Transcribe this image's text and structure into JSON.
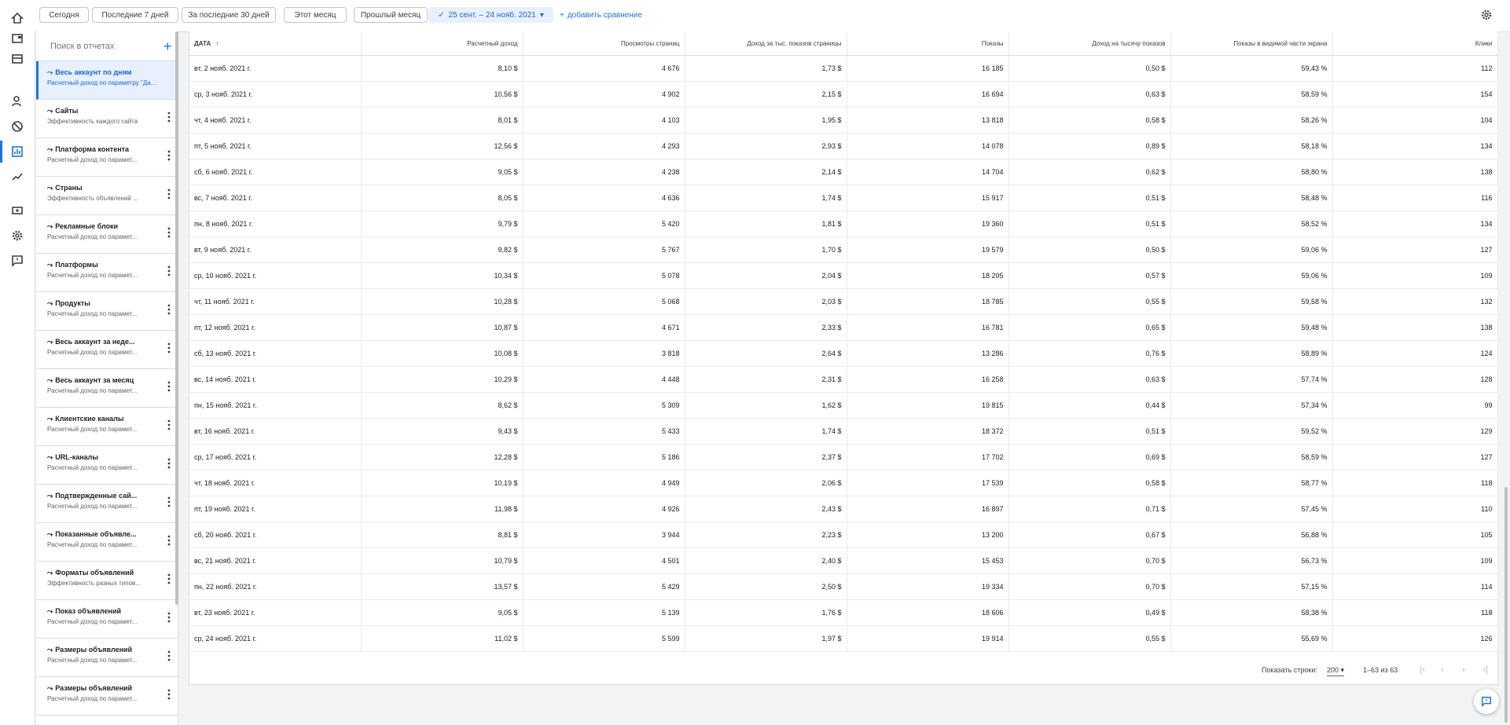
{
  "filters": {
    "today": "Сегодня",
    "last7": "Последние 7 дней",
    "last30": "За последние 30 дней",
    "this_month": "Этот месяц",
    "last_month": "Прошлый месяц",
    "range": "25 сент. – 24 нояб. 2021",
    "add_compare": "добавить сравнение"
  },
  "sidebar": {
    "search_placeholder": "Поиск в отчетах",
    "reports": [
      {
        "title": "Весь аккаунт по дням",
        "subtitle": "Расчетный доход по параметру \"Дата\""
      },
      {
        "title": "Сайты",
        "subtitle": "Эффективность каждого сайта"
      },
      {
        "title": "Платформа контента",
        "subtitle": "Расчетный доход по парамет..."
      },
      {
        "title": "Страны",
        "subtitle": "Эффективность объявлений ..."
      },
      {
        "title": "Рекламные блоки",
        "subtitle": "Расчетный доход по парамет..."
      },
      {
        "title": "Платформы",
        "subtitle": "Расчетный доход по парамет..."
      },
      {
        "title": "Продукты",
        "subtitle": "Расчетный доход по парамет..."
      },
      {
        "title": "Весь аккаунт за неде...",
        "subtitle": "Расчетный доход по парамет..."
      },
      {
        "title": "Весь аккаунт за месяц",
        "subtitle": "Расчетный доход по парамет..."
      },
      {
        "title": "Клиентские каналы",
        "subtitle": "Расчетный доход по парамет..."
      },
      {
        "title": "URL-каналы",
        "subtitle": "Расчетный доход по парамет..."
      },
      {
        "title": "Подтвержденные сай...",
        "subtitle": "Расчетный доход по парамет..."
      },
      {
        "title": "Показанные объявле...",
        "subtitle": "Расчетный доход по парамет..."
      },
      {
        "title": "Форматы объявлений",
        "subtitle": "Эффективность разных типов..."
      },
      {
        "title": "Показ объявлений",
        "subtitle": "Расчетный доход по парамет..."
      },
      {
        "title": "Размеры объявлений",
        "subtitle": "Расчетный доход по парамет..."
      },
      {
        "title": "Размеры объявлений",
        "subtitle": "Расчетный доход по парамет..."
      }
    ]
  },
  "table": {
    "headers": [
      "ДАТА",
      "Расчетный доход",
      "Просмотры страниц",
      "Доход за тыс. показов страницы",
      "Показы",
      "Доход на тысячу показов",
      "Показы в видимой части экрана",
      "Клики"
    ],
    "sort_arrow": "↑",
    "rows": [
      [
        "вт, 2 нояб. 2021 г.",
        "8,10 $",
        "4 676",
        "1,73 $",
        "16 185",
        "0,50 $",
        "59,43 %",
        "112"
      ],
      [
        "ср, 3 нояб. 2021 г.",
        "10,56 $",
        "4 902",
        "2,15 $",
        "16 694",
        "0,63 $",
        "58,59 %",
        "154"
      ],
      [
        "чт, 4 нояб. 2021 г.",
        "8,01 $",
        "4 103",
        "1,95 $",
        "13 818",
        "0,58 $",
        "58,26 %",
        "104"
      ],
      [
        "пт, 5 нояб. 2021 г.",
        "12,56 $",
        "4 293",
        "2,93 $",
        "14 078",
        "0,89 $",
        "58,18 %",
        "134"
      ],
      [
        "сб, 6 нояб. 2021 г.",
        "9,05 $",
        "4 238",
        "2,14 $",
        "14 704",
        "0,62 $",
        "58,80 %",
        "138"
      ],
      [
        "вс, 7 нояб. 2021 г.",
        "8,05 $",
        "4 636",
        "1,74 $",
        "15 917",
        "0,51 $",
        "58,48 %",
        "116"
      ],
      [
        "пн, 8 нояб. 2021 г.",
        "9,79 $",
        "5 420",
        "1,81 $",
        "19 360",
        "0,51 $",
        "58,52 %",
        "134"
      ],
      [
        "вт, 9 нояб. 2021 г.",
        "9,82 $",
        "5 767",
        "1,70 $",
        "19 579",
        "0,50 $",
        "59,06 %",
        "127"
      ],
      [
        "ср, 10 нояб. 2021 г.",
        "10,34 $",
        "5 078",
        "2,04 $",
        "18 205",
        "0,57 $",
        "59,06 %",
        "109"
      ],
      [
        "чт, 11 нояб. 2021 г.",
        "10,28 $",
        "5 068",
        "2,03 $",
        "18 785",
        "0,55 $",
        "59,58 %",
        "132"
      ],
      [
        "пт, 12 нояб. 2021 г.",
        "10,87 $",
        "4 671",
        "2,33 $",
        "16 781",
        "0,65 $",
        "59,48 %",
        "138"
      ],
      [
        "сб, 13 нояб. 2021 г.",
        "10,08 $",
        "3 818",
        "2,64 $",
        "13 286",
        "0,76 $",
        "58,89 %",
        "124"
      ],
      [
        "вс, 14 нояб. 2021 г.",
        "10,29 $",
        "4 448",
        "2,31 $",
        "16 258",
        "0,63 $",
        "57,74 %",
        "128"
      ],
      [
        "пн, 15 нояб. 2021 г.",
        "8,62 $",
        "5 309",
        "1,62 $",
        "19 815",
        "0,44 $",
        "57,34 %",
        "99"
      ],
      [
        "вт, 16 нояб. 2021 г.",
        "9,43 $",
        "5 433",
        "1,74 $",
        "18 372",
        "0,51 $",
        "59,52 %",
        "129"
      ],
      [
        "ср, 17 нояб. 2021 г.",
        "12,28 $",
        "5 186",
        "2,37 $",
        "17 702",
        "0,69 $",
        "58,59 %",
        "127"
      ],
      [
        "чт, 18 нояб. 2021 г.",
        "10,19 $",
        "4 949",
        "2,06 $",
        "17 539",
        "0,58 $",
        "58,77 %",
        "118"
      ],
      [
        "пт, 19 нояб. 2021 г.",
        "11,98 $",
        "4 926",
        "2,43 $",
        "16 897",
        "0,71 $",
        "57,45 %",
        "110"
      ],
      [
        "сб, 20 нояб. 2021 г.",
        "8,81 $",
        "3 944",
        "2,23 $",
        "13 200",
        "0,67 $",
        "56,88 %",
        "105"
      ],
      [
        "вс, 21 нояб. 2021 г.",
        "10,79 $",
        "4 501",
        "2,40 $",
        "15 453",
        "0,70 $",
        "56,73 %",
        "109"
      ],
      [
        "пн, 22 нояб. 2021 г.",
        "13,57 $",
        "5 429",
        "2,50 $",
        "19 334",
        "0,70 $",
        "57,15 %",
        "114"
      ],
      [
        "вт, 23 нояб. 2021 г.",
        "9,05 $",
        "5 139",
        "1,76 $",
        "18 606",
        "0,49 $",
        "58,38 %",
        "118"
      ],
      [
        "ср, 24 нояб. 2021 г.",
        "11,02 $",
        "5 599",
        "1,97 $",
        "19 914",
        "0,55 $",
        "55,69 %",
        "126"
      ]
    ]
  },
  "pagination": {
    "rows_label": "Показать строки:",
    "rows_value": "200",
    "count": "1–63 из 63"
  },
  "colors": {
    "accent": "#1a73e8",
    "active_bg": "#e8f0fe"
  },
  "icons": [
    "home-icon",
    "display-icon",
    "layout-icon",
    "users-icon",
    "block-icon",
    "reports-icon",
    "trending-icon",
    "payments-icon",
    "settings-icon",
    "feedback-icon"
  ]
}
